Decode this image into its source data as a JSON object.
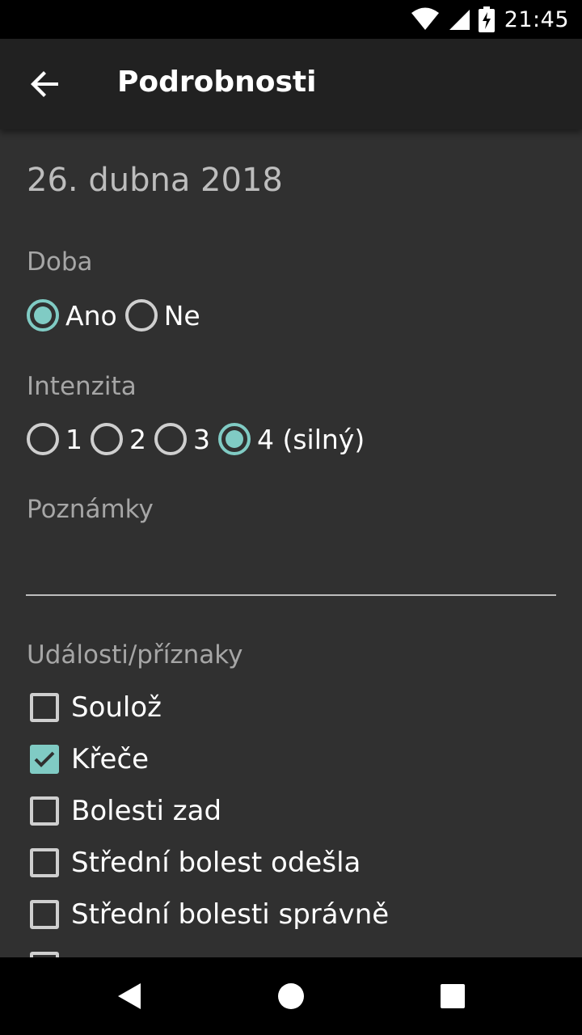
{
  "status_bar": {
    "time": "21:45",
    "icons": [
      "wifi-icon",
      "signal-icon",
      "battery-charging-icon"
    ]
  },
  "app_bar": {
    "title": "Podrobnosti",
    "back_icon": "arrow-back-icon"
  },
  "date": "26. dubna 2018",
  "doba": {
    "label": "Doba",
    "options": [
      {
        "label": "Ano",
        "selected": true
      },
      {
        "label": "Ne",
        "selected": false
      }
    ]
  },
  "intenzita": {
    "label": "Intenzita",
    "options": [
      {
        "label": "1",
        "selected": false
      },
      {
        "label": "2",
        "selected": false
      },
      {
        "label": "3",
        "selected": false
      },
      {
        "label": "4 (silný)",
        "selected": true
      }
    ]
  },
  "poznamky": {
    "label": "Poznámky",
    "value": ""
  },
  "events": {
    "label": "Události/příznaky",
    "items": [
      {
        "label": "Soulož",
        "checked": false
      },
      {
        "label": "Křeče",
        "checked": true
      },
      {
        "label": "Bolesti zad",
        "checked": false
      },
      {
        "label": "Střední bolest odešla",
        "checked": false
      },
      {
        "label": "Střední bolesti správně",
        "checked": false
      }
    ]
  },
  "colors": {
    "accent": "#80cbc4",
    "background": "#303030",
    "app_bar": "#212121"
  },
  "nav_bar": {
    "buttons": [
      "back-triangle-icon",
      "home-circle-icon",
      "recents-square-icon"
    ]
  }
}
